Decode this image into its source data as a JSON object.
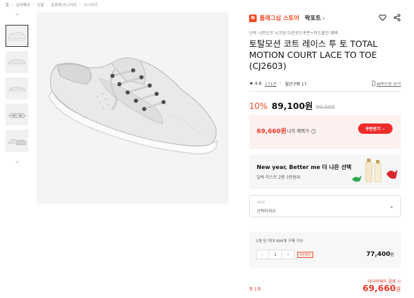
{
  "breadcrumb": [
    "홈",
    "남성패션",
    "신발",
    "운동화/스니커즈",
    "스니커즈"
  ],
  "store": {
    "logo_glyph": "N",
    "name": "플래그십 스토어",
    "brand": "락포트",
    "brand_arrow": "›",
    "icons": [
      "heart-icon",
      "share-icon"
    ]
  },
  "product": {
    "promo_text": "단독 시즌오프 시크릿 다운로드쿠폰+카드할인 혜택",
    "title": "토탈모션 코트 레이스 투 토 TOTAL MOTION COURT LACE TO TOE (CJ2603)",
    "rating": "4.8",
    "reviews": "171건",
    "monthly_buy": "월간구매 17",
    "app_link": "APP으로 보기"
  },
  "price": {
    "discount": "10%",
    "sale": "89,100원",
    "original": "99,000"
  },
  "coupon": {
    "price": "69,660원",
    "label": "나의 혜택가",
    "button": "쿠폰받기"
  },
  "banner": {
    "title": "New year, Better me 더 나은 선택",
    "subtitle": "달바 미스트 2병 3만원대"
  },
  "select": {
    "label": "사이즈",
    "value": "선택하세요."
  },
  "quantity": {
    "note": "1명 당 최대 999개 구매 가능",
    "minus": "−",
    "value": "1",
    "plus": "+",
    "coupon_tag": "쿠폰할인",
    "price": "77,400",
    "price_unit": "원"
  },
  "total": {
    "note": "네이버페이 결제 시",
    "label": "총 1개",
    "price": "69,660",
    "price_unit": "원"
  },
  "colors": {
    "accent": "#f04a23",
    "red": "#e8392a"
  }
}
